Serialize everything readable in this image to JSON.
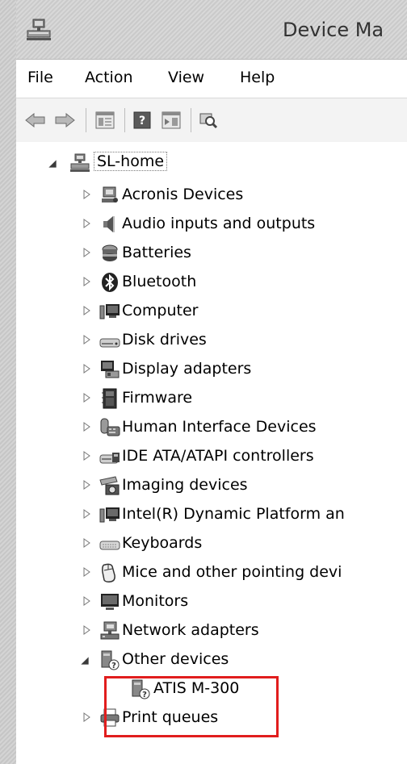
{
  "window": {
    "title": "Device Ma",
    "icon": "device-manager-icon"
  },
  "menu": [
    "File",
    "Action",
    "View",
    "Help"
  ],
  "toolbar": {
    "buttons": [
      "back-arrow-icon",
      "forward-arrow-icon",
      "properties-icon",
      "help-icon",
      "update-driver-icon",
      "scan-hardware-icon"
    ]
  },
  "tree": {
    "root": {
      "label": "SL-home",
      "expanded": true,
      "icon": "computer-network-icon"
    },
    "categories": [
      {
        "label": "Acronis Devices",
        "icon": "acronis-device-icon",
        "expanded": false
      },
      {
        "label": "Audio inputs and outputs",
        "icon": "speaker-icon",
        "expanded": false
      },
      {
        "label": "Batteries",
        "icon": "battery-icon",
        "expanded": false
      },
      {
        "label": "Bluetooth",
        "icon": "bluetooth-icon",
        "expanded": false
      },
      {
        "label": "Computer",
        "icon": "computer-icon",
        "expanded": false
      },
      {
        "label": "Disk drives",
        "icon": "disk-drive-icon",
        "expanded": false
      },
      {
        "label": "Display adapters",
        "icon": "display-adapter-icon",
        "expanded": false
      },
      {
        "label": "Firmware",
        "icon": "firmware-icon",
        "expanded": false
      },
      {
        "label": "Human Interface Devices",
        "icon": "hid-icon",
        "expanded": false
      },
      {
        "label": "IDE ATA/ATAPI controllers",
        "icon": "ide-controller-icon",
        "expanded": false
      },
      {
        "label": "Imaging devices",
        "icon": "camera-icon",
        "expanded": false
      },
      {
        "label": "Intel(R) Dynamic Platform an",
        "icon": "computer-icon",
        "expanded": false
      },
      {
        "label": "Keyboards",
        "icon": "keyboard-icon",
        "expanded": false
      },
      {
        "label": "Mice and other pointing devi",
        "icon": "mouse-icon",
        "expanded": false
      },
      {
        "label": "Monitors",
        "icon": "monitor-icon",
        "expanded": false
      },
      {
        "label": "Network adapters",
        "icon": "network-adapter-icon",
        "expanded": false
      },
      {
        "label": "Other devices",
        "icon": "unknown-device-icon",
        "expanded": true,
        "children": [
          {
            "label": "ATIS M-300",
            "icon": "unknown-device-icon"
          }
        ]
      },
      {
        "label": "Print queues",
        "icon": "printer-icon",
        "expanded": false
      }
    ]
  },
  "colors": {
    "highlight": "#e11d1d",
    "frame": "#d2d2d2",
    "toolbar": "#f3f3f3"
  }
}
